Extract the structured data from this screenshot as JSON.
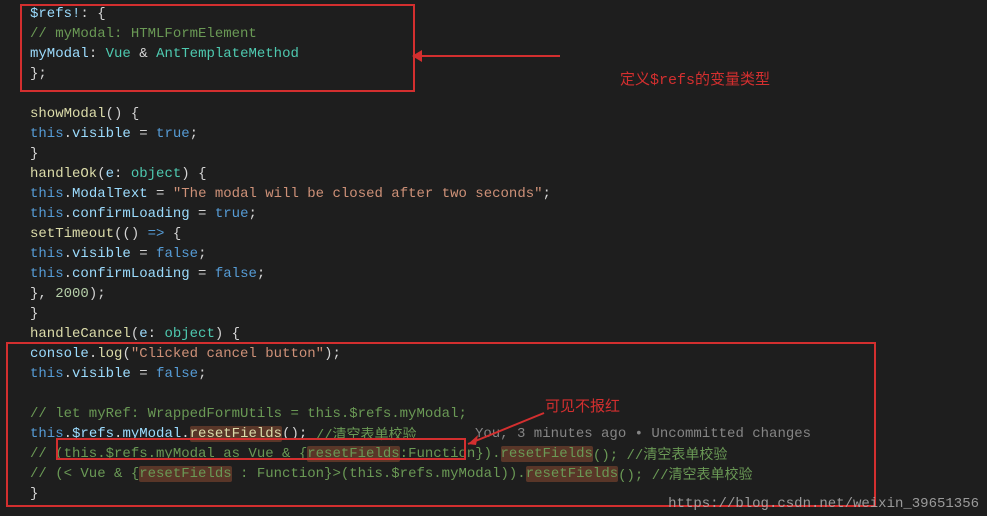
{
  "annotations": {
    "label1": "定义$refs的变量类型",
    "label2": "可见不报红",
    "git": "You, 3 minutes ago • Uncommitted changes",
    "watermark": "https://blog.csdn.net/weixin_39651356"
  },
  "code": {
    "l1_a": "$refs!",
    "l1_b": ": {",
    "l2": "// myModal: HTMLFormElement",
    "l3_a": "myModal",
    "l3_b": ": ",
    "l3_c": "Vue",
    "l3_d": " & ",
    "l3_e": "AntTemplateMethod",
    "l4": "};",
    "l6_a": "showModal",
    "l6_b": "() {",
    "l7_a": "this",
    "l7_b": ".",
    "l7_c": "visible",
    "l7_d": " = ",
    "l7_e": "true",
    "l7_f": ";",
    "l8": "}",
    "l9_a": "handleOk",
    "l9_b": "(",
    "l9_c": "e",
    "l9_d": ": ",
    "l9_e": "object",
    "l9_f": ") {",
    "l10_a": "this",
    "l10_b": ".",
    "l10_c": "ModalText",
    "l10_d": " = ",
    "l10_e": "\"The modal will be closed after two seconds\"",
    "l10_f": ";",
    "l11_a": "this",
    "l11_b": ".",
    "l11_c": "confirmLoading",
    "l11_d": " = ",
    "l11_e": "true",
    "l11_f": ";",
    "l12_a": "setTimeout",
    "l12_b": "(() ",
    "l12_c": "=>",
    "l12_d": " {",
    "l13_a": "this",
    "l13_b": ".",
    "l13_c": "visible",
    "l13_d": " = ",
    "l13_e": "false",
    "l13_f": ";",
    "l14_a": "this",
    "l14_b": ".",
    "l14_c": "confirmLoading",
    "l14_d": " = ",
    "l14_e": "false",
    "l14_f": ";",
    "l15_a": "}, ",
    "l15_b": "2000",
    "l15_c": ");",
    "l16": "}",
    "l17_a": "handleCancel",
    "l17_b": "(",
    "l17_c": "e",
    "l17_d": ": ",
    "l17_e": "object",
    "l17_f": ") {",
    "l18_a": "console",
    "l18_b": ".",
    "l18_c": "log",
    "l18_d": "(",
    "l18_e": "\"Clicked cancel button\"",
    "l18_f": ");",
    "l19_a": "this",
    "l19_b": ".",
    "l19_c": "visible",
    "l19_d": " = ",
    "l19_e": "false",
    "l19_f": ";",
    "l21": "// let myRef: WrappedFormUtils = this.$refs.myModal;",
    "l22_a": "this",
    "l22_b": ".",
    "l22_c": "$refs",
    "l22_d": ".",
    "l22_e": "myModal",
    "l22_f": ".",
    "l22_g": "resetFields",
    "l22_h": "();",
    "l22_i": " //清空表单校验",
    "l23_a": "// (this.$refs.myModal as Vue & {",
    "l23_b": "resetFields",
    "l23_c": ":Function}).",
    "l23_d": "resetFields",
    "l23_e": "(); //清空表单校验",
    "l24_a": "// (< Vue & {",
    "l24_b": "resetFields",
    "l24_c": " : Function}>(this.$refs.myModal)).",
    "l24_d": "resetFields",
    "l24_e": "(); //清空表单校验",
    "l25": "}"
  }
}
